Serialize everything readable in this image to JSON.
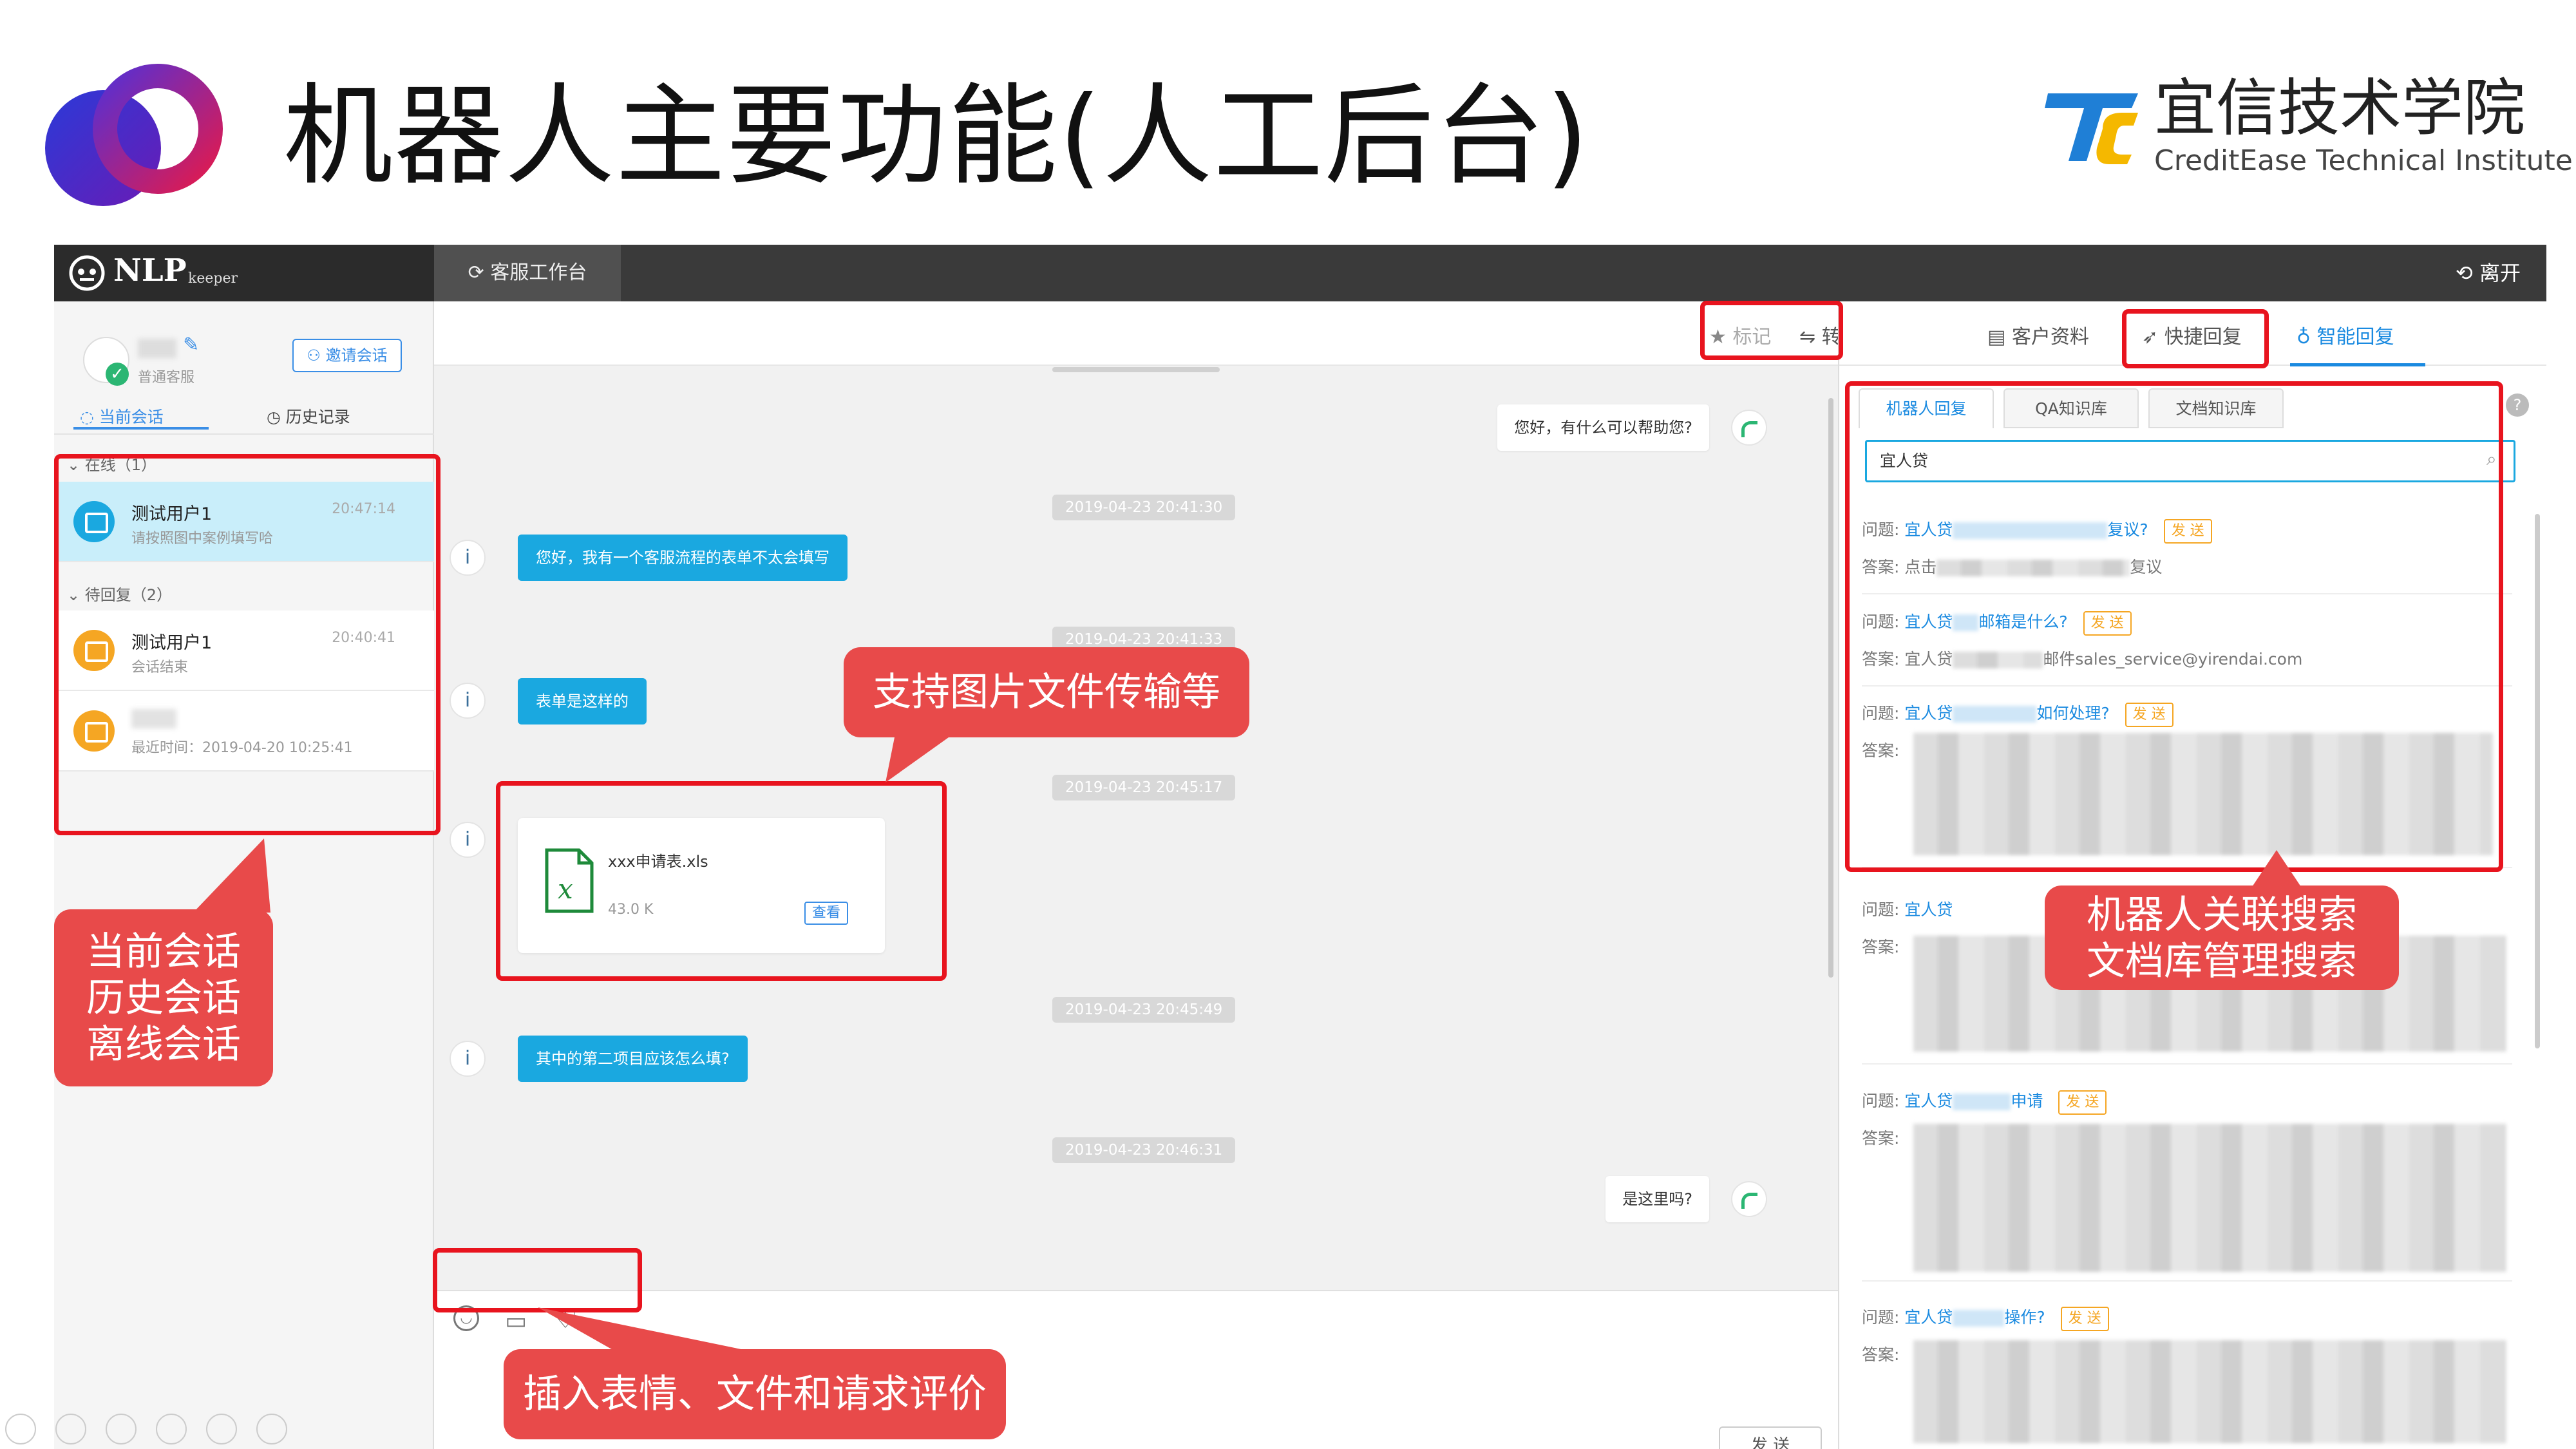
{
  "slide": {
    "title": "机器人主要功能(人工后台)"
  },
  "brand": {
    "name_cn": "宜信技术学院",
    "name_en": "CreditEase Technical Institute"
  },
  "app": {
    "logo": "NLP",
    "logo_sub": "keeper",
    "workbench_label": "客服工作台",
    "leave_label": "离开",
    "agent": {
      "role": "普通客服",
      "invite_label": "邀请会话"
    },
    "left_tabs": [
      {
        "label": "当前会话"
      },
      {
        "label": "历史记录"
      }
    ],
    "online_group": "在线（1）",
    "pending_group": "待回复（2）",
    "sessions": [
      {
        "name": "测试用户1",
        "sub": "请按照图中案例填写哈",
        "time": "20:47:14"
      },
      {
        "name": "测试用户1",
        "sub": "会话结束",
        "time": "20:40:41"
      },
      {
        "name": "",
        "sub": "最近时间：2019-04-20 10:25:41",
        "time": ""
      }
    ],
    "chat_actions": {
      "mark": "标记",
      "transfer": "转接"
    },
    "messages": {
      "greet": "您好，有什么可以帮助您?",
      "ts1": "2019-04-23 20:41:30",
      "m1": "您好，我有一个客服流程的表单不太会填写",
      "ts2": "2019-04-23 20:41:33",
      "m2": "表单是这样的",
      "ts3": "2019-04-23 20:45:17",
      "file_name": "xxx申请表.xls",
      "file_size": "43.0 K",
      "file_view": "查看",
      "ts4": "2019-04-23 20:45:49",
      "m3": "其中的第二项目应该怎么填?",
      "ts5": "2019-04-23 20:46:31",
      "reply2": "是这里吗?"
    },
    "send_label": "发 送",
    "right_tabs": [
      {
        "label": "客户资料"
      },
      {
        "label": "快捷回复"
      },
      {
        "label": "智能回复"
      }
    ],
    "sub_tabs": [
      {
        "label": "机器人回复"
      },
      {
        "label": "QA知识库"
      },
      {
        "label": "文档知识库"
      }
    ],
    "search_value": "宜人贷",
    "q_label": "问题:",
    "a_label": "答案:",
    "send_tag": "发 送",
    "qa": [
      {
        "q_pre": "宜人贷",
        "q_post": "复议?",
        "a_pre": "点击",
        "a_post": "复议"
      },
      {
        "q_pre": "宜人贷",
        "q_post": "邮箱是什么?",
        "a_pre": "宜人贷",
        "a_post": "邮件sales_service@yirendai.com"
      },
      {
        "q_pre": "宜人贷",
        "q_post": "如何处理?",
        "a_pre": "",
        "a_post": ""
      },
      {
        "q_pre": "宜人贷",
        "q_post": "",
        "a_pre": "",
        "a_post": ""
      },
      {
        "q_pre": "宜人贷",
        "q_post": "申请",
        "a_pre": "",
        "a_post": ""
      },
      {
        "q_pre": "宜人贷",
        "q_post": "操作?",
        "a_pre": "",
        "a_post": ""
      }
    ]
  },
  "callouts": {
    "file_transfer": "支持图片文件传输等",
    "sessions": [
      "当前会话",
      "历史会话",
      "离线会话"
    ],
    "search": [
      "机器人关联搜索",
      "文档库管理搜索"
    ],
    "input_tools": "插入表情、文件和请求评价"
  }
}
